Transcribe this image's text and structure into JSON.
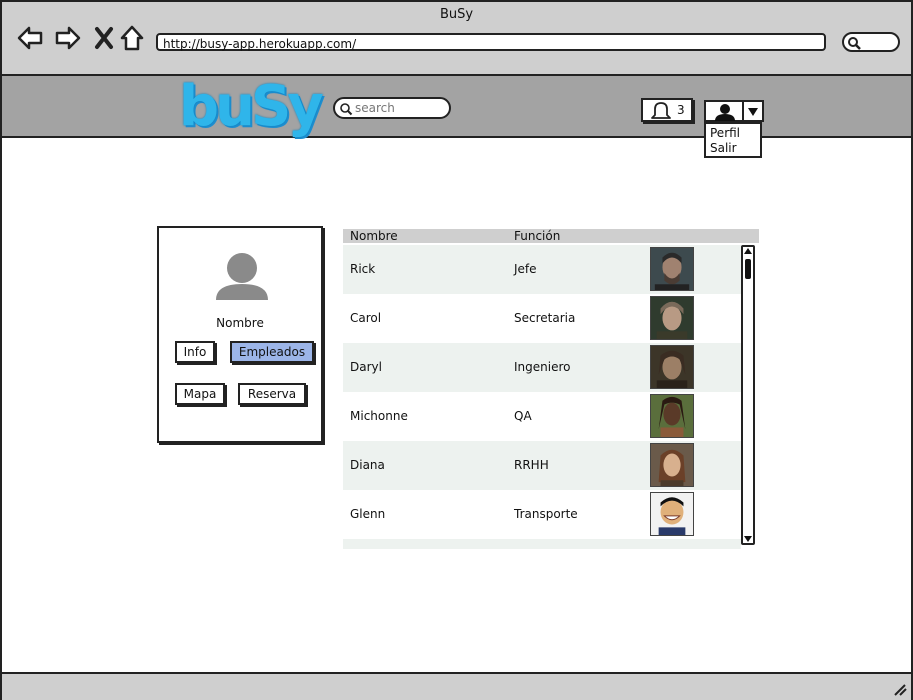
{
  "window": {
    "title": "BuSy",
    "url": "http://busy-app.herokuapp.com/"
  },
  "header": {
    "logo_text": "buSy",
    "search_placeholder": "search",
    "notification_count": "3",
    "user_menu": [
      "Perfil",
      "Salir"
    ]
  },
  "profile": {
    "name_label": "Nombre",
    "buttons": {
      "info": "Info",
      "empleados": "Empleados",
      "mapa": "Mapa",
      "reserva": "Reserva"
    },
    "active_tab": "Empleados"
  },
  "employees": {
    "columns": [
      "Nombre",
      "Función"
    ],
    "rows": [
      {
        "nombre": "Rick",
        "funcion": "Jefe",
        "photo_icon": "portrait-rick"
      },
      {
        "nombre": "Carol",
        "funcion": "Secretaria",
        "photo_icon": "portrait-carol"
      },
      {
        "nombre": "Daryl",
        "funcion": "Ingeniero",
        "photo_icon": "portrait-daryl"
      },
      {
        "nombre": "Michonne",
        "funcion": "QA",
        "photo_icon": "portrait-michonne"
      },
      {
        "nombre": "Diana",
        "funcion": "RRHH",
        "photo_icon": "portrait-diana"
      },
      {
        "nombre": "Glenn",
        "funcion": "Transporte",
        "photo_icon": "portrait-glenn"
      }
    ]
  },
  "colors": {
    "accent_active_button": "#9cb5e8",
    "logo": "#2fb5ea",
    "chrome": "#cfcfcf",
    "appbar": "#a3a3a3",
    "row_alt": "#edf2ef"
  }
}
